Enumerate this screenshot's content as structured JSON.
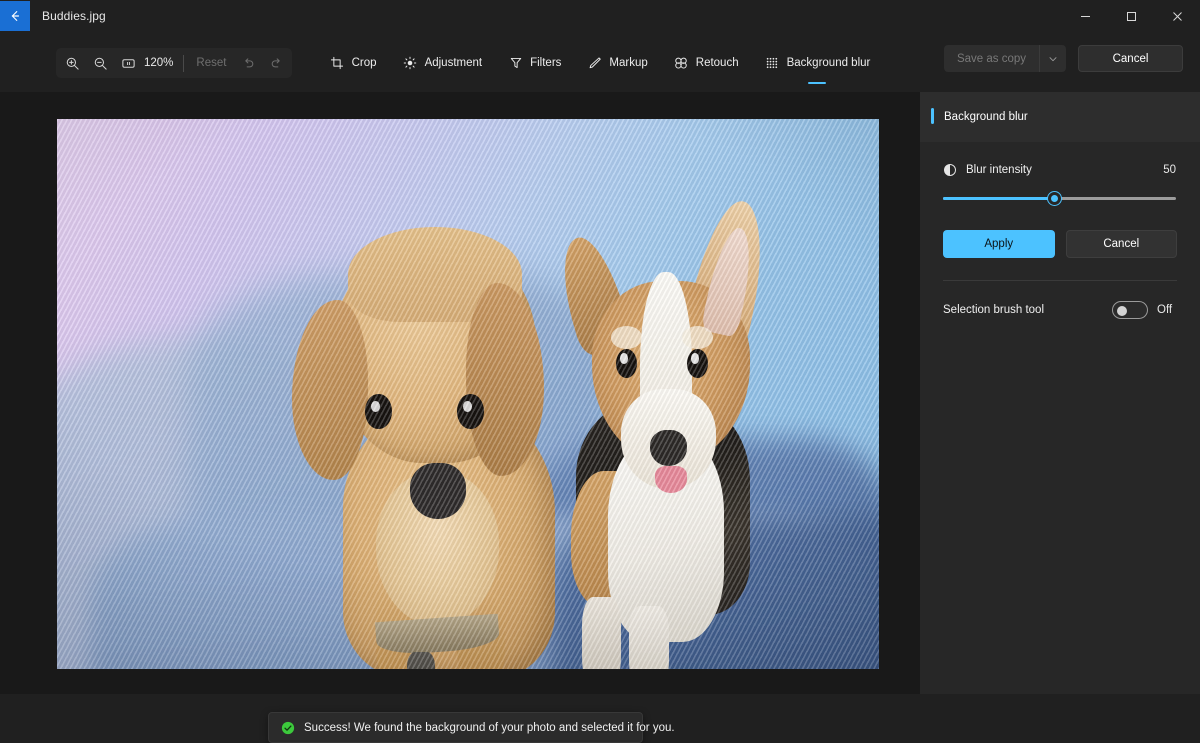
{
  "window": {
    "title": "Buddies.jpg",
    "back_icon": "back-arrow-icon",
    "minimize_label": "−",
    "maximize_label": "□",
    "close_label": "✕",
    "accent_color": "#1a6fd4"
  },
  "zoom_toolbar": {
    "zoom_in_icon": "zoom-in-icon",
    "zoom_out_icon": "zoom-out-icon",
    "fit_icon": "fit-to-window-icon",
    "zoom_level": "120%",
    "reset_label": "Reset",
    "undo_icon": "undo-icon",
    "redo_icon": "redo-icon"
  },
  "menubar": {
    "items": [
      {
        "label": "Crop",
        "icon": "crop-icon",
        "active": false
      },
      {
        "label": "Adjustment",
        "icon": "brightness-icon",
        "active": false
      },
      {
        "label": "Filters",
        "icon": "filter-funnel-icon",
        "active": false
      },
      {
        "label": "Markup",
        "icon": "pen-icon",
        "active": false
      },
      {
        "label": "Retouch",
        "icon": "retouch-spot-icon",
        "active": false
      },
      {
        "label": "Background blur",
        "icon": "background-blur-icon",
        "active": true
      }
    ]
  },
  "top_actions": {
    "save_as_copy_label": "Save as copy",
    "save_dropdown_icon": "chevron-down-icon",
    "cancel_label": "Cancel"
  },
  "panel": {
    "title": "Background blur",
    "accent_color": "#4cc2ff",
    "blur_intensity": {
      "icon": "contrast-icon",
      "label": "Blur intensity",
      "value": "50",
      "slider_percent": 48,
      "min": 0,
      "max": 100
    },
    "apply_label": "Apply",
    "cancel_label": "Cancel",
    "selection_brush": {
      "label": "Selection brush tool",
      "state": "Off",
      "checked": false
    }
  },
  "toast": {
    "icon": "success-check-icon",
    "message": "Success! We found the background of your photo and selected it for you.",
    "icon_color": "#3cc93c"
  },
  "photo": {
    "subject": "Two puppies on a couch — goldendoodle and Pembroke Welsh Corgi",
    "background_state": "blurred"
  }
}
